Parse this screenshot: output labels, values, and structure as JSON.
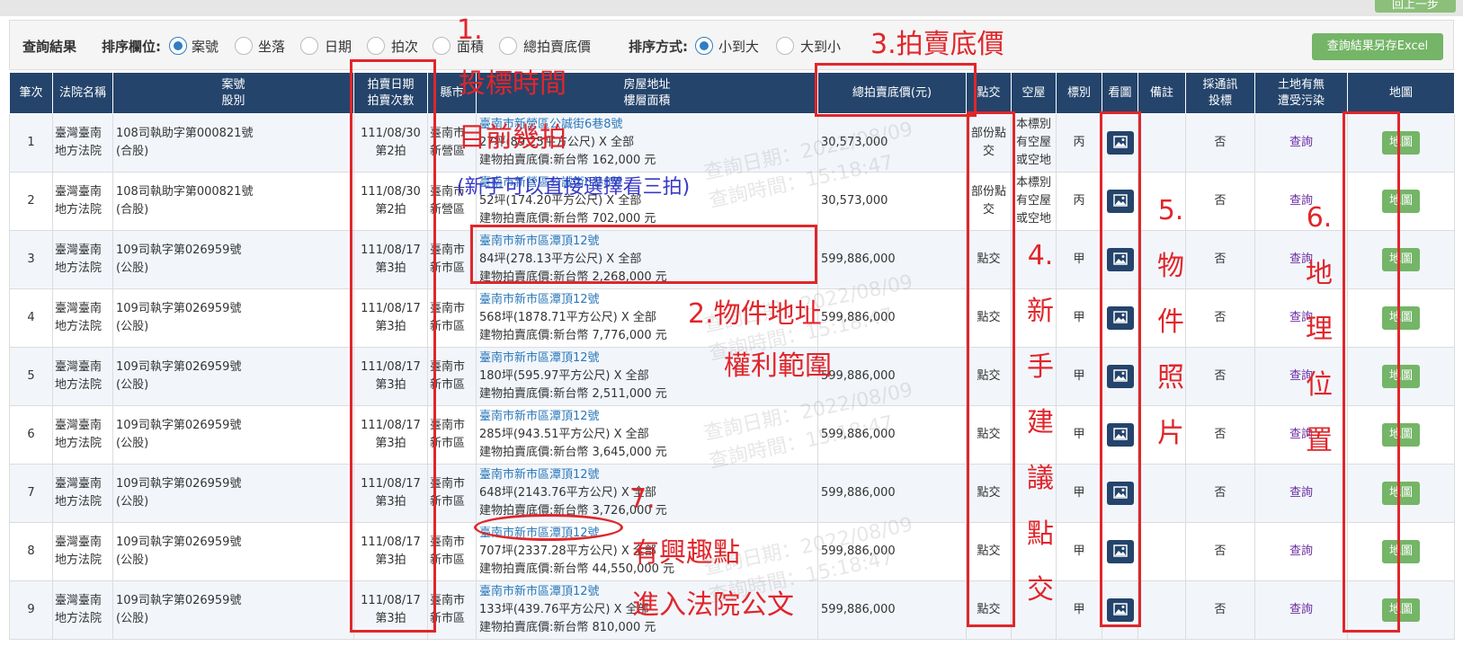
{
  "top_button": "回上一步",
  "toolbar": {
    "title": "查詢結果",
    "sort_field_label": "排序欄位:",
    "sort_fields": [
      "案號",
      "坐落",
      "日期",
      "拍次",
      "面積",
      "總拍賣底價"
    ],
    "sort_order_label": "排序方式:",
    "sort_orders": [
      "小到大",
      "大到小"
    ],
    "excel_button": "查詢結果另存Excel"
  },
  "columns": [
    "筆次",
    "法院名稱",
    "案號\n股別",
    "拍賣日期\n拍賣次數",
    "縣市",
    "房屋地址\n樓層面積",
    "總拍賣底價(元)",
    "點交",
    "空屋",
    "標別",
    "看圖",
    "備註",
    "採通訊\n投標",
    "土地有無\n遭受污染",
    "地圖"
  ],
  "rows": [
    {
      "no": "1",
      "court": "臺灣臺南\n地方法院",
      "case": "108司執助字第000821號\n(合股)",
      "date": "111/08/30\n第2拍",
      "city": "臺南市\n新營區",
      "addr": "臺南市新營區公誠街6巷8號",
      "area": "27坪(89.25平方公尺) X 全部",
      "bprice": "建物拍賣底價:新台幣 162,000 元",
      "price": "30,573,000",
      "handover": "部份點\n交",
      "vacant": "本標別\n有空屋\n或空地",
      "grade": "丙",
      "remark": "",
      "comm": "否",
      "pollution": "查詢",
      "map": "地圖"
    },
    {
      "no": "2",
      "court": "臺灣臺南\n地方法院",
      "case": "108司執助字第000821號\n(合股)",
      "date": "111/08/30\n第2拍",
      "city": "臺南市\n新營區",
      "addr": "臺南市新營區公誠街6巷8號",
      "area": "52坪(174.20平方公尺) X 全部",
      "bprice": "建物拍賣底價:新台幣 702,000 元",
      "price": "30,573,000",
      "handover": "部份點\n交",
      "vacant": "本標別\n有空屋\n或空地",
      "grade": "丙",
      "remark": "",
      "comm": "否",
      "pollution": "查詢",
      "map": "地圖"
    },
    {
      "no": "3",
      "court": "臺灣臺南\n地方法院",
      "case": "109司執字第026959號\n(公股)",
      "date": "111/08/17\n第3拍",
      "city": "臺南市\n新市區",
      "addr": "臺南市新市區潭頂12號",
      "area": "84坪(278.13平方公尺) X 全部",
      "bprice": "建物拍賣底價:新台幣 2,268,000 元",
      "price": "599,886,000",
      "handover": "點交",
      "vacant": "",
      "grade": "甲",
      "remark": "",
      "comm": "否",
      "pollution": "查詢",
      "map": "地圖"
    },
    {
      "no": "4",
      "court": "臺灣臺南\n地方法院",
      "case": "109司執字第026959號\n(公股)",
      "date": "111/08/17\n第3拍",
      "city": "臺南市\n新市區",
      "addr": "臺南市新市區潭頂12號",
      "area": "568坪(1878.71平方公尺) X 全部",
      "bprice": "建物拍賣底價:新台幣 7,776,000 元",
      "price": "599,886,000",
      "handover": "點交",
      "vacant": "",
      "grade": "甲",
      "remark": "",
      "comm": "否",
      "pollution": "查詢",
      "map": "地圖"
    },
    {
      "no": "5",
      "court": "臺灣臺南\n地方法院",
      "case": "109司執字第026959號\n(公股)",
      "date": "111/08/17\n第3拍",
      "city": "臺南市\n新市區",
      "addr": "臺南市新市區潭頂12號",
      "area": "180坪(595.97平方公尺) X 全部",
      "bprice": "建物拍賣底價:新台幣 2,511,000 元",
      "price": "599,886,000",
      "handover": "點交",
      "vacant": "",
      "grade": "甲",
      "remark": "",
      "comm": "否",
      "pollution": "查詢",
      "map": "地圖"
    },
    {
      "no": "6",
      "court": "臺灣臺南\n地方法院",
      "case": "109司執字第026959號\n(公股)",
      "date": "111/08/17\n第3拍",
      "city": "臺南市\n新市區",
      "addr": "臺南市新市區潭頂12號",
      "area": "285坪(943.51平方公尺) X 全部",
      "bprice": "建物拍賣底價:新台幣 3,645,000 元",
      "price": "599,886,000",
      "handover": "點交",
      "vacant": "",
      "grade": "甲",
      "remark": "",
      "comm": "否",
      "pollution": "查詢",
      "map": "地圖"
    },
    {
      "no": "7",
      "court": "臺灣臺南\n地方法院",
      "case": "109司執字第026959號\n(公股)",
      "date": "111/08/17\n第3拍",
      "city": "臺南市\n新市區",
      "addr": "臺南市新市區潭頂12號",
      "area": "648坪(2143.76平方公尺) X 全部",
      "bprice": "建物拍賣底價:新台幣 3,726,000 元",
      "price": "599,886,000",
      "handover": "點交",
      "vacant": "",
      "grade": "甲",
      "remark": "",
      "comm": "否",
      "pollution": "查詢",
      "map": "地圖"
    },
    {
      "no": "8",
      "court": "臺灣臺南\n地方法院",
      "case": "109司執字第026959號\n(公股)",
      "date": "111/08/17\n第3拍",
      "city": "臺南市\n新市區",
      "addr": "臺南市新市區潭頂12號",
      "area": "707坪(2337.28平方公尺) X 全部",
      "bprice": "建物拍賣底價:新台幣 44,550,000 元",
      "price": "599,886,000",
      "handover": "點交",
      "vacant": "",
      "grade": "甲",
      "remark": "",
      "comm": "否",
      "pollution": "查詢",
      "map": "地圖"
    },
    {
      "no": "9",
      "court": "臺灣臺南\n地方法院",
      "case": "109司執字第026959號\n(公股)",
      "date": "111/08/17\n第3拍",
      "city": "臺南市\n新市區",
      "addr": "臺南市新市區潭頂12號",
      "area": "133坪(439.76平方公尺) X 全部",
      "bprice": "建物拍賣底價:新台幣 810,000 元",
      "price": "599,886,000",
      "handover": "點交",
      "vacant": "",
      "grade": "甲",
      "remark": "",
      "comm": "否",
      "pollution": "查詢",
      "map": "地圖"
    }
  ],
  "watermark": {
    "date": "查詢日期：2022/08/09",
    "time": "查詢時間：15:18:47"
  },
  "annotations": {
    "a1_num": "1.",
    "a1": "投標時間",
    "a1_sub": "目前幾拍",
    "a1_note": "(新手可以直接選擇看三拍)",
    "a2a": "2.物件地址",
    "a2b": "權利範圍",
    "a3": "3.拍賣底價",
    "a4": "4.新手建議點交",
    "a5": "5.物件照片",
    "a6": "6.地理位置",
    "a7_num": "7.",
    "a7a": "有興趣點",
    "a7b": "進入法院公文"
  }
}
